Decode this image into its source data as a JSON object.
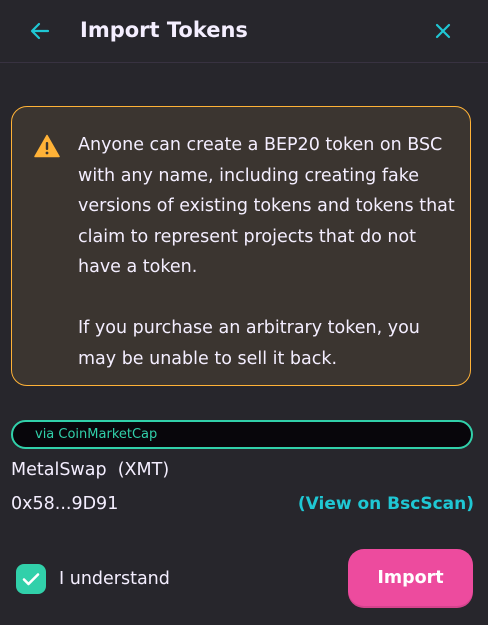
{
  "header": {
    "title": "Import Tokens",
    "back_icon": "arrow-left-icon",
    "close_icon": "close-icon"
  },
  "warning": {
    "icon": "warning-triangle-icon",
    "paragraph_1": "Anyone can create a BEP20 token on BSC with any name, including creating fake versions of existing tokens and tokens that claim to represent projects that do not have a token.",
    "paragraph_2": "If you purchase an arbitrary token, you may be unable to sell it back."
  },
  "token": {
    "source": "via CoinMarketCap",
    "name": "MetalSwap",
    "symbol": "(XMT)",
    "address": "0x58...9D91",
    "explorer_link": "(View on BscScan)"
  },
  "footer": {
    "checkbox_checked": true,
    "checkbox_icon": "checkmark-icon",
    "understand_label": "I understand",
    "import_label": "Import"
  },
  "colors": {
    "background": "#27262c",
    "text": "#f4eeff",
    "accent_teal": "#31d0aa",
    "accent_cyan": "#1fc7d4",
    "warning_border": "#ffb237",
    "primary_button": "#ed4b9e"
  }
}
